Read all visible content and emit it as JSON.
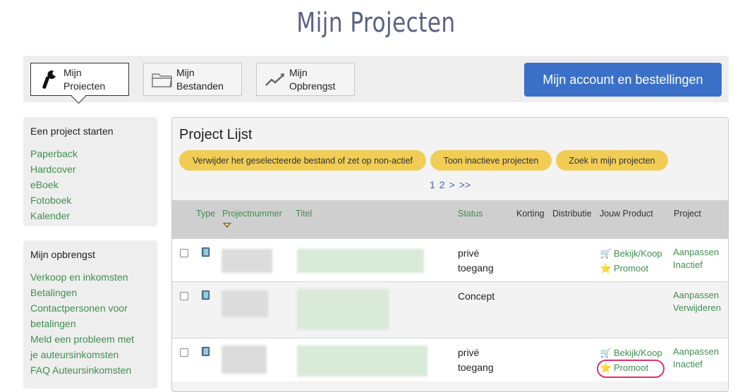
{
  "page_title": "Mijn Projecten",
  "topnav": {
    "items": [
      {
        "label_line1": "Mijn",
        "label_line2": "Projecten",
        "icon": "wrench-icon",
        "active": true
      },
      {
        "label_line1": "Mijn",
        "label_line2": "Bestanden",
        "icon": "folder-icon",
        "active": false
      },
      {
        "label_line1": "Mijn",
        "label_line2": "Opbrengst",
        "icon": "trend-chart-icon",
        "active": false
      }
    ],
    "account_button": "Mijn account en bestellingen"
  },
  "sidebar": {
    "start": {
      "title": "Een project starten",
      "links": [
        "Paperback",
        "Hardcover",
        "eBoek",
        "Fotoboek",
        "Kalender"
      ]
    },
    "revenue": {
      "title": "Mijn opbrengst",
      "links": [
        "Verkoop en inkomsten",
        "Betalingen",
        "Contactpersonen voor",
        "betalingen",
        "Meld een probleem met",
        "je auteursinkomsten",
        "FAQ Auteursinkomsten"
      ]
    }
  },
  "panel": {
    "title": "Project Lijst",
    "buttons": {
      "delete": "Verwijder het geselecteerde bestand of zet op non-actief",
      "inactive": "Toon inactieve projecten",
      "search": "Zoek in mijn projecten"
    },
    "pager": [
      "1",
      "2",
      ">",
      ">>"
    ],
    "columns": {
      "type": "Type",
      "number": "Projectnummer",
      "title": "Titel",
      "status": "Status",
      "discount": "Korting",
      "distribution": "Distributie",
      "product": "Jouw Product",
      "project": "Project"
    },
    "rows": [
      {
        "status_line1": "privé",
        "status_line2": "toegang",
        "product_view": "Bekijk/Koop",
        "product_promote": "Promoot",
        "action1": "Aanpassen",
        "action2": "Inactief"
      },
      {
        "status_line1": "Concept",
        "status_line2": "",
        "action1": "Aanpassen",
        "action2": "Verwijderen"
      },
      {
        "status_line1": "privé",
        "status_line2": "toegang",
        "product_view": "Bekijk/Koop",
        "product_promote": "Promoot",
        "action1": "Aanpassen",
        "action2": "Inactief"
      }
    ]
  },
  "colors": {
    "accent_blue": "#3b70c8",
    "link_green": "#3f8f4f",
    "pill_yellow": "#f1cd56",
    "highlight_pink": "#e0306f"
  }
}
